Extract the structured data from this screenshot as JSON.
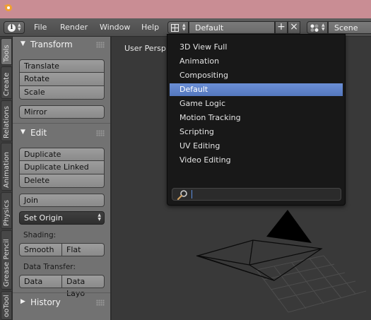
{
  "header": {
    "menus": [
      "File",
      "Render",
      "Window",
      "Help"
    ],
    "screen_layout": "Default",
    "scene": "Scene"
  },
  "vertical_tabs": [
    "Tools",
    "Create",
    "Relations",
    "Animation",
    "Physics",
    "Grease Pencil",
    "ooTool"
  ],
  "tool_shelf": {
    "transform": {
      "title": "Transform",
      "buttons": [
        "Translate",
        "Rotate",
        "Scale"
      ],
      "mirror": "Mirror"
    },
    "edit": {
      "title": "Edit",
      "buttons": [
        "Duplicate",
        "Duplicate Linked",
        "Delete"
      ],
      "join": "Join",
      "set_origin": "Set Origin",
      "shading_label": "Shading:",
      "shading": [
        "Smooth",
        "Flat"
      ],
      "data_transfer_label": "Data Transfer:",
      "data_transfer": [
        "Data",
        "Data Layo"
      ]
    },
    "history": {
      "title": "History"
    }
  },
  "viewport": {
    "label": "User Persp"
  },
  "layout_menu": {
    "items": [
      "3D View Full",
      "Animation",
      "Compositing",
      "Default",
      "Game Logic",
      "Motion Tracking",
      "Scripting",
      "UV Editing",
      "Video Editing"
    ],
    "selected": "Default",
    "search_value": ""
  },
  "colors": {
    "title_bar": "#c98d94",
    "selection": "#5680c2",
    "tool_shelf": "#727272",
    "viewport": "#393939"
  }
}
